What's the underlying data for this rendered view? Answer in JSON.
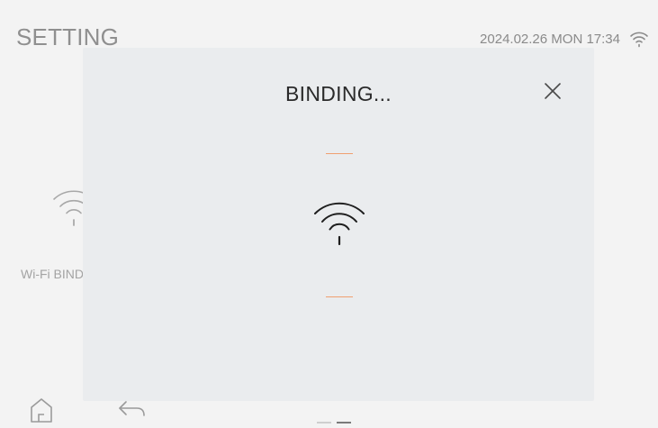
{
  "header": {
    "title": "SETTING",
    "datetime": "2024.02.26 MON 17:34",
    "wifi_icon": "wifi-icon"
  },
  "background": {
    "wifi_label": "Wi-Fi BINDING",
    "wifi_icon": "wifi-icon"
  },
  "navigation": {
    "home_icon": "home-icon",
    "back_icon": "back-arrow-icon",
    "pages": 2,
    "active_page": 2
  },
  "modal": {
    "title": "BINDING...",
    "close_icon": "close-icon",
    "status_icon": "wifi-icon"
  },
  "colors": {
    "background": "#f3f3f3",
    "modal": "#eaecee",
    "accent": "#f0a070",
    "title_text": "#2a2a2a"
  }
}
